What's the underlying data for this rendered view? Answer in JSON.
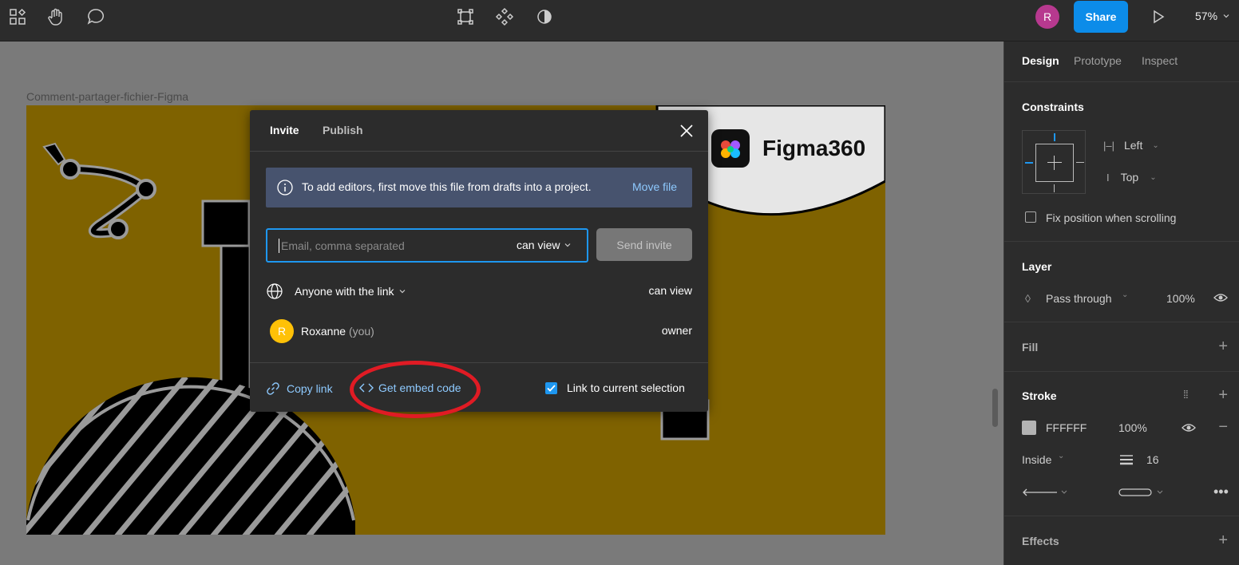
{
  "toolbar": {
    "avatar_initial": "R",
    "share_label": "Share",
    "zoom": "57%"
  },
  "canvas": {
    "frame_label": "Comment-partager-fichier-Figma",
    "logo_text": "Figma360"
  },
  "dialog": {
    "tabs": [
      "Invite",
      "Publish"
    ],
    "banner_text": "To add editors, first move this file from drafts into a project.",
    "banner_link": "Move file",
    "email_placeholder": "Email, comma separated",
    "permission": "can view",
    "send_label": "Send invite",
    "link_access": "Anyone with the link",
    "link_permission": "can view",
    "user_initial": "R",
    "user_name": "Roxanne",
    "user_suffix": "(you)",
    "user_role": "owner",
    "copy_link": "Copy link",
    "embed_code": "Get embed code",
    "link_selection": "Link to current selection",
    "link_selection_checked": true
  },
  "panel": {
    "tabs": [
      "Design",
      "Prototype",
      "Inspect"
    ],
    "constraints": {
      "title": "Constraints",
      "horizontal": "Left",
      "vertical": "Top",
      "fix_position": "Fix position when scrolling"
    },
    "layer": {
      "title": "Layer",
      "blend": "Pass through",
      "opacity": "100%"
    },
    "fill": {
      "title": "Fill"
    },
    "stroke": {
      "title": "Stroke",
      "color": "FFFFFF",
      "opacity": "100%",
      "position": "Inside",
      "weight": "16"
    },
    "effects": {
      "title": "Effects"
    }
  },
  "colors": {
    "accent": "#0c8ce9",
    "frame_yellow": "#7f6200",
    "banner": "#47536e",
    "highlight": "#e01b24"
  }
}
